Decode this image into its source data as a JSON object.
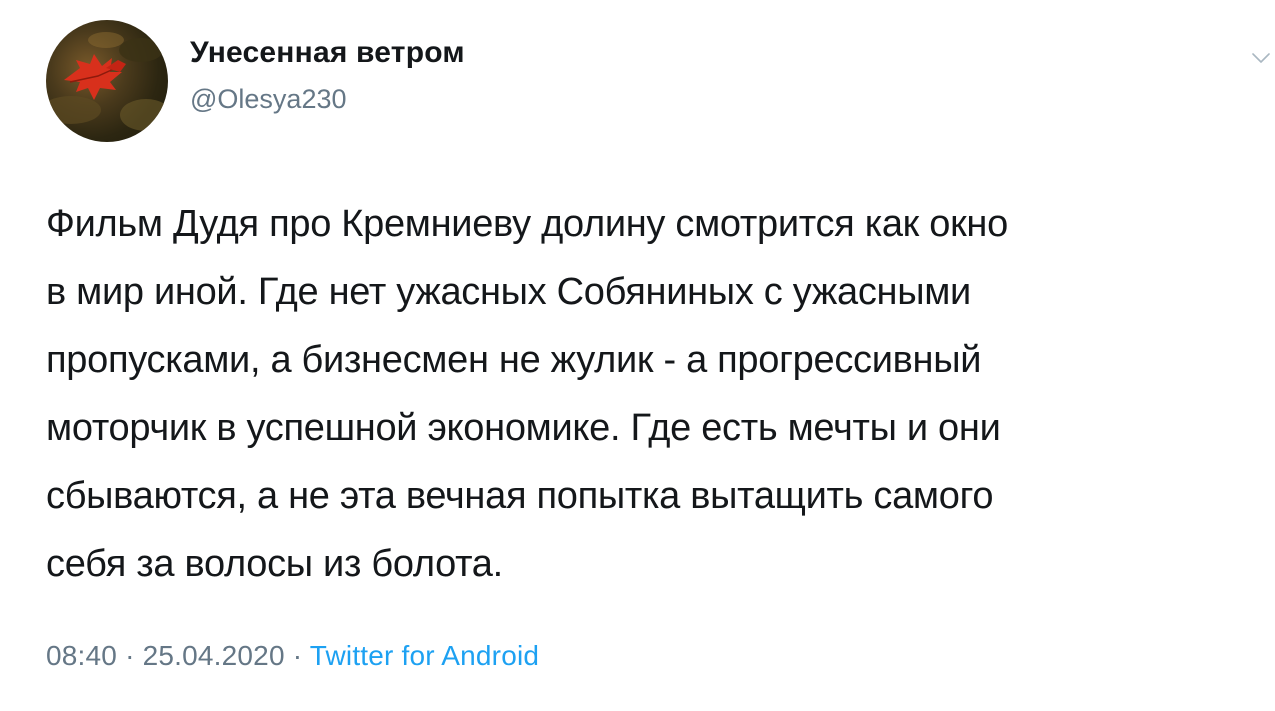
{
  "tweet": {
    "author": {
      "display_name": "Унесенная ветром",
      "handle": "@Olesya230",
      "avatar_icon": "red-leaf-avatar"
    },
    "menu_icon": "chevron-down-icon",
    "text_lines": [
      "Фильм Дудя про Кремниеву долину смотрится как окно",
      "в мир иной. Где нет ужасных Собяниных с ужасными",
      "пропусками, а бизнесмен не жулик - а прогрессивный",
      "моторчик в успешной экономике. Где есть мечты и они",
      "сбываются, а не эта вечная попытка вытащить самого",
      "себя за волосы из болота."
    ],
    "time": "08:40",
    "separator": "·",
    "date": "25.04.2020",
    "source": "Twitter for Android"
  },
  "colors": {
    "text": "#14171a",
    "secondary": "#657786",
    "link": "#1da1f2",
    "chevron": "#aab8c2"
  }
}
